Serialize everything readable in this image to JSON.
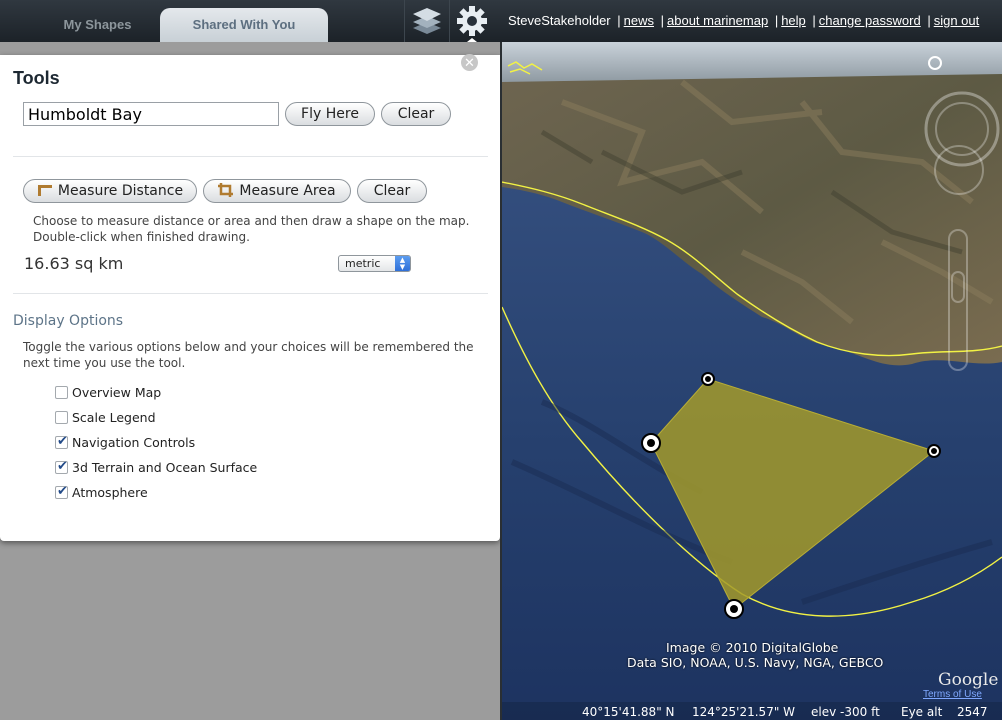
{
  "tabs": [
    {
      "label": "My Shapes",
      "active": false
    },
    {
      "label": "Shared With You",
      "active": true
    }
  ],
  "toolbar_icons": [
    "layers-icon",
    "gear-icon"
  ],
  "user_links": {
    "username": "SteveStakeholder",
    "items": [
      "news",
      "about marinemap",
      "help",
      "change password",
      "sign out"
    ]
  },
  "tools": {
    "title": "Tools",
    "location_value": "Humboldt Bay",
    "fly_here": "Fly Here",
    "clear": "Clear",
    "measure_distance": "Measure Distance",
    "measure_area": "Measure Area",
    "measure_clear": "Clear",
    "measure_help": "Choose to measure distance or area and then draw a shape on the map. Double-click when finished drawing.",
    "measure_result": "16.63 sq km",
    "units_selected": "metric"
  },
  "display_options": {
    "title": "Display Options",
    "help": "Toggle the various options below and your choices will be remembered the next time you use the tool.",
    "options": [
      {
        "label": "Overview Map",
        "checked": false
      },
      {
        "label": "Scale Legend",
        "checked": false
      },
      {
        "label": "Navigation Controls",
        "checked": true
      },
      {
        "label": "3d Terrain and Ocean Surface",
        "checked": true
      },
      {
        "label": "Atmosphere",
        "checked": true
      }
    ]
  },
  "map": {
    "credit_line1": "Image © 2010 DigitalGlobe",
    "credit_line2": "Data SIO, NOAA, U.S. Navy, NGA, GEBCO",
    "logo_text": "Google",
    "terms": "Terms of Use",
    "lat": "40°15'41.88\" N",
    "lon": "124°25'21.57\" W",
    "elev": "elev  -300 ft",
    "eye_alt_label": "Eye alt",
    "eye_alt_value": "2547",
    "polygon_color": "#a39a2a",
    "boundary_color": "#f2f244"
  }
}
